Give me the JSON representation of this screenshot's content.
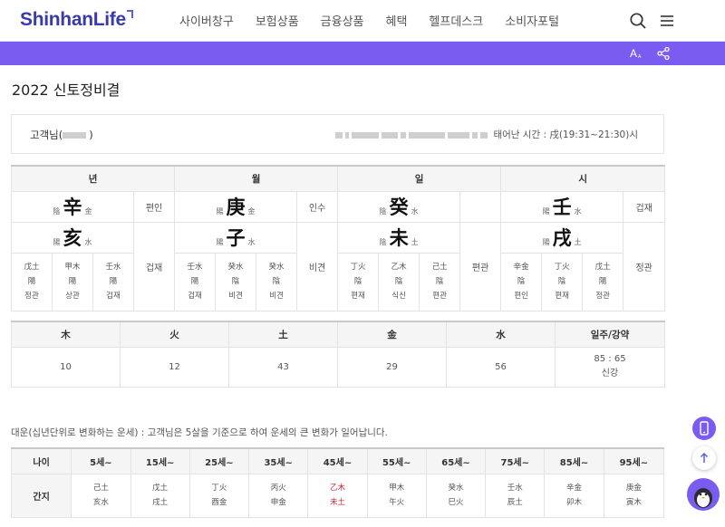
{
  "header": {
    "logo": "ShinhanLife",
    "nav": [
      "사이버창구",
      "보험상품",
      "금융상품",
      "혜택",
      "헬프데스크",
      "소비자포털"
    ],
    "icons": [
      "search-icon",
      "menu-icon"
    ]
  },
  "util_bar": {
    "color": "#7b5cf0",
    "icons": [
      "font-size-icon",
      "share-icon"
    ]
  },
  "page": {
    "title": "2022 신토정비결"
  },
  "customer": {
    "name_prefix": "고객님(",
    "name_suffix": ")",
    "time_text": "태어난 시간 : 戌(19:31~21:30)시"
  },
  "saju": {
    "pillars": [
      {
        "header": "년",
        "stem": {
          "yy": "陰",
          "char": "辛",
          "el": "金",
          "rel": "편인"
        },
        "branch": {
          "yy": "陽",
          "char": "亥",
          "el": "水",
          "rel": "겁재"
        },
        "hidden": [
          {
            "gz": "戊土",
            "yy": "陽",
            "rel": "정관"
          },
          {
            "gz": "甲木",
            "yy": "陽",
            "rel": "상관"
          },
          {
            "gz": "壬水",
            "yy": "陽",
            "rel": "겁재"
          }
        ]
      },
      {
        "header": "월",
        "stem": {
          "yy": "陽",
          "char": "庚",
          "el": "金",
          "rel": "인수"
        },
        "branch": {
          "yy": "陽",
          "char": "子",
          "el": "水",
          "rel": "비견"
        },
        "hidden": [
          {
            "gz": "壬水",
            "yy": "陽",
            "rel": "겁재"
          },
          {
            "gz": "癸水",
            "yy": "陰",
            "rel": "비견"
          },
          {
            "gz": "癸水",
            "yy": "陰",
            "rel": "비견"
          }
        ]
      },
      {
        "header": "일",
        "stem": {
          "yy": "陰",
          "char": "癸",
          "el": "水",
          "rel": ""
        },
        "branch": {
          "yy": "陰",
          "char": "未",
          "el": "土",
          "rel": "편관"
        },
        "hidden": [
          {
            "gz": "丁火",
            "yy": "陰",
            "rel": "편재"
          },
          {
            "gz": "乙木",
            "yy": "陰",
            "rel": "식신"
          },
          {
            "gz": "己土",
            "yy": "陰",
            "rel": "편관"
          }
        ]
      },
      {
        "header": "시",
        "stem": {
          "yy": "陽",
          "char": "壬",
          "el": "水",
          "rel": "겁재"
        },
        "branch": {
          "yy": "陽",
          "char": "戌",
          "el": "土",
          "rel": "정관"
        },
        "hidden": [
          {
            "gz": "辛金",
            "yy": "陰",
            "rel": "편인"
          },
          {
            "gz": "丁火",
            "yy": "陰",
            "rel": "편재"
          },
          {
            "gz": "戊土",
            "yy": "陽",
            "rel": "정관"
          }
        ]
      }
    ]
  },
  "elements": {
    "headers": [
      "木",
      "火",
      "土",
      "金",
      "水",
      "일주/강약"
    ],
    "values": [
      "10",
      "12",
      "43",
      "29",
      "56"
    ],
    "strength": {
      "ratio": "85 : 65",
      "label": "신강"
    }
  },
  "daeun": {
    "note": "대운(십년단위로 변화하는 운세) : 고객님은 5살을 기준으로 하여 운세의 큰 변화가 일어납니다.",
    "row_headers": [
      "나이",
      "간지"
    ],
    "periods": [
      {
        "age": "5세~",
        "stem": "己土",
        "branch": "亥水"
      },
      {
        "age": "15세~",
        "stem": "戊土",
        "branch": "戌土"
      },
      {
        "age": "25세~",
        "stem": "丁火",
        "branch": "酉金"
      },
      {
        "age": "35세~",
        "stem": "丙火",
        "branch": "申金"
      },
      {
        "age": "45세~",
        "stem": "乙木",
        "branch": "未土",
        "highlight": true
      },
      {
        "age": "55세~",
        "stem": "甲木",
        "branch": "午火"
      },
      {
        "age": "65세~",
        "stem": "癸水",
        "branch": "巳火"
      },
      {
        "age": "75세~",
        "stem": "壬水",
        "branch": "辰土"
      },
      {
        "age": "85세~",
        "stem": "辛金",
        "branch": "卯木"
      },
      {
        "age": "95세~",
        "stem": "庚金",
        "branch": "寅木"
      }
    ],
    "highlight_color": "#cc2233"
  },
  "fab_icons": [
    "mobile-icon",
    "arrow-up-icon",
    "penguin-icon"
  ]
}
